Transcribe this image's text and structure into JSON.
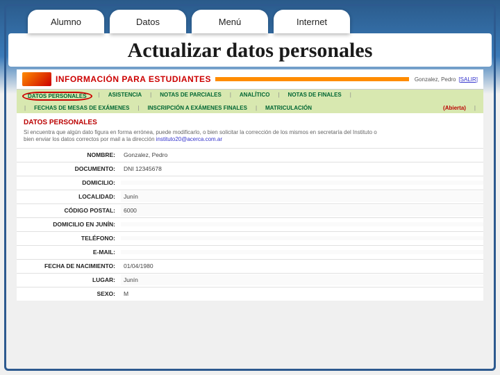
{
  "tabs": [
    "Alumno",
    "Datos",
    "Menú",
    "Internet"
  ],
  "title": "Actualizar datos personales",
  "banner": {
    "text": "INFORMACIÓN PARA ESTUDIANTES",
    "user": "Gonzalez, Pedro",
    "logout": "[SALIR]"
  },
  "nav1": {
    "items": [
      "DATOS PERSONALES",
      "ASISTENCIA",
      "NOTAS DE PARCIALES",
      "ANALÍTICO",
      "NOTAS DE FINALES"
    ]
  },
  "nav2": {
    "items": [
      "FECHAS DE MESAS DE EXÁMENES",
      "INSCRIPCIÓN A EXÁMENES FINALES",
      "MATRICULACIÓN"
    ],
    "status": "(Abierta)"
  },
  "section": "DATOS PERSONALES",
  "hint_a": "Si encuentra que algún dato figura en forma errónea, puede modificarlo, o bien solicitar la corrección de los mismos en secretaría del Instituto o",
  "hint_b": "bien enviar los datos correctos por mail a la dirección ",
  "hint_mail": "instituto20@acerca.com.ar",
  "fields": [
    {
      "label": "NOMBRE:",
      "value": "Gonzalez, Pedro",
      "editable": false
    },
    {
      "label": "DOCUMENTO:",
      "value": "DNI 12345678",
      "editable": false
    },
    {
      "label": "DOMICILIO:",
      "value": "",
      "editable": true
    },
    {
      "label": "LOCALIDAD:",
      "value": "Junín",
      "editable": true
    },
    {
      "label": "CÓDIGO POSTAL:",
      "value": "6000",
      "editable": true
    },
    {
      "label": "DOMICILIO EN JUNÍN:",
      "value": "",
      "editable": true
    },
    {
      "label": "TELÉFONO:",
      "value": "",
      "editable": true
    },
    {
      "label": "E-MAIL:",
      "value": "",
      "editable": true
    },
    {
      "label": "FECHA DE NACIMIENTO:",
      "value": "01/04/1980",
      "editable": false
    },
    {
      "label": "LUGAR:",
      "value": "Junín",
      "editable": true
    },
    {
      "label": "SEXO:",
      "value": "M",
      "editable": false
    }
  ]
}
